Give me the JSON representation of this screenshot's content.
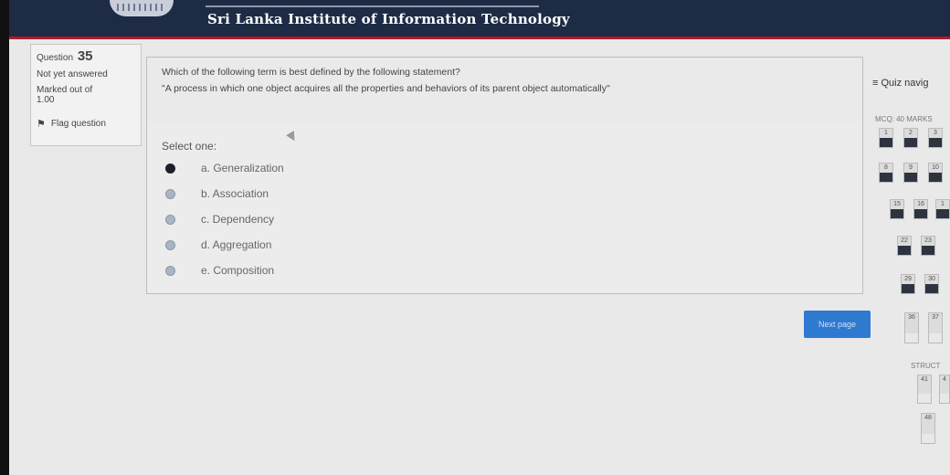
{
  "header": {
    "site_title": "Sri Lanka Institute of Information Technology"
  },
  "info": {
    "question_label": "Question",
    "question_number": "35",
    "status": "Not yet answered",
    "marked_label": "Marked out of",
    "marked_value": "1.00",
    "flag_label": "Flag question"
  },
  "question": {
    "text": "Which of the following term is best defined by the following statement?",
    "statement": "\"A process in which one object acquires all the properties and behaviors of its parent object automatically\"",
    "select_one": "Select one:",
    "options": [
      {
        "label": "a. Generalization",
        "checked": true
      },
      {
        "label": "b. Association",
        "checked": false
      },
      {
        "label": "c. Dependency",
        "checked": false
      },
      {
        "label": "d. Aggregation",
        "checked": false
      },
      {
        "label": "e. Composition",
        "checked": false
      }
    ]
  },
  "next_button": "Next page",
  "nav": {
    "title": "≡ Quiz navig",
    "section1": "MCQ: 40 MARKS",
    "section2": "STRUCT",
    "cells": [
      "1",
      "2",
      "3",
      "8",
      "9",
      "10",
      "15",
      "16",
      "1",
      "22",
      "23",
      "29",
      "30",
      "36",
      "37",
      "41",
      "4",
      "48"
    ]
  }
}
